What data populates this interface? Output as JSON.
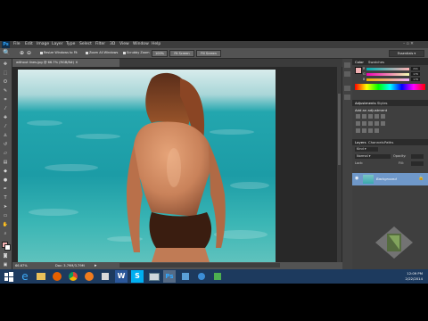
{
  "app": {
    "logo": "Ps",
    "menu": [
      "File",
      "Edit",
      "Image",
      "Layer",
      "Type",
      "Select",
      "Filter",
      "3D",
      "View",
      "Window",
      "Help"
    ]
  },
  "options_bar": {
    "resize_windows": "Resize Windows to Fit",
    "zoom_all": "Zoom All Windows",
    "scrubby_zoom": "Scrubby Zoom",
    "btn_100": "100%",
    "btn_fit": "Fit Screen",
    "btn_fill": "Fill Screen",
    "workspace": "Essentials"
  },
  "document": {
    "tab_title": "without lines.jpg @ 66.7% (RGB/8#)",
    "zoom": "66.67%",
    "doc_info": "Doc: 3.79M/3.79M"
  },
  "color_panel": {
    "tabs": [
      "Color",
      "Swatches"
    ],
    "channels": [
      {
        "label": "R",
        "value": "241"
      },
      {
        "label": "G",
        "value": "176"
      },
      {
        "label": "B",
        "value": "178"
      }
    ]
  },
  "adjustments_panel": {
    "tabs": [
      "Adjustments",
      "Styles"
    ],
    "heading": "Add an adjustment"
  },
  "layers_panel": {
    "tabs": [
      "Layers",
      "Channels",
      "Paths"
    ],
    "filter": "Kind",
    "blend_mode": "Normal",
    "opacity_label": "Opacity:",
    "lock_label": "Lock:",
    "fill_label": "Fill:",
    "layer_name": "Background"
  },
  "taskbar": {
    "time": "12:09 PM",
    "date": "2/22/2014"
  },
  "colors": {
    "app_bg": "#535353",
    "panel_bg": "#3f3f3f",
    "selected_layer": "#6f98c9",
    "taskbar": "#1d3a5e",
    "ps_blue": "#31a8ff"
  }
}
